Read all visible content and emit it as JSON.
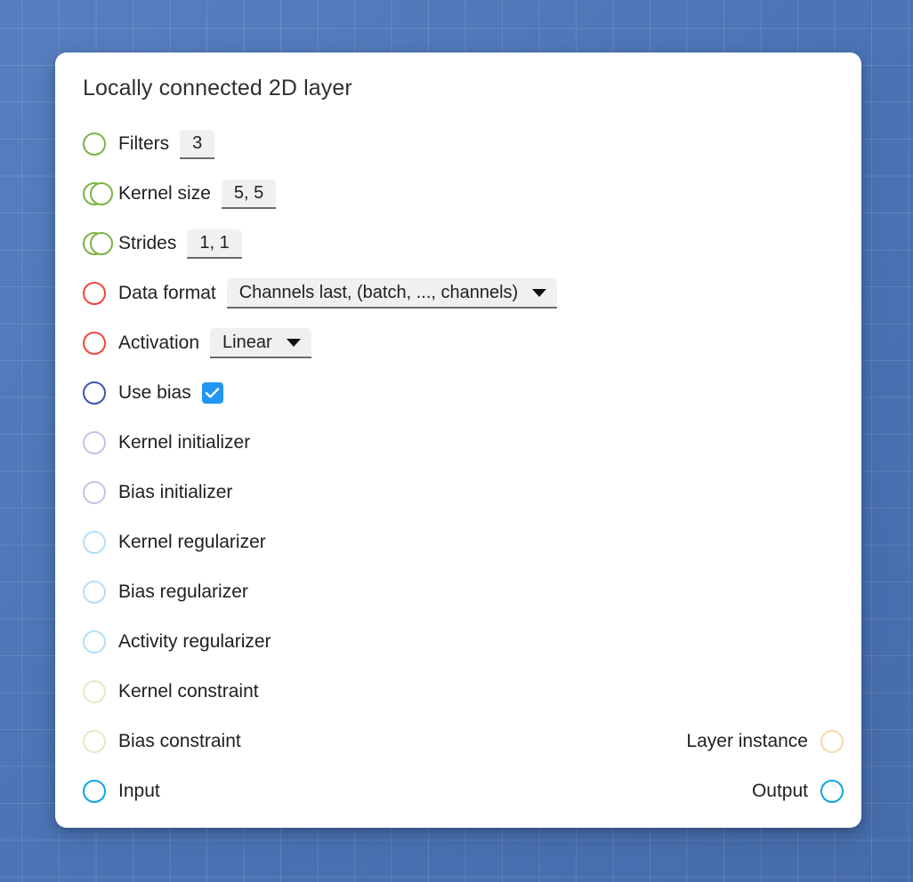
{
  "window": {
    "backdrop_color": "#4d78bd",
    "grid_line_color": "rgba(255,255,255,0.13)"
  },
  "card": {
    "title": "Locally connected 2D layer",
    "background": "#ffffff"
  },
  "rows": [
    {
      "id": "filters",
      "port_icon": "single-circle-icon",
      "port_color": "#7cb342",
      "label": "Filters",
      "control": "text-field",
      "value": "3"
    },
    {
      "id": "kernel-size",
      "port_icon": "double-circle-icon",
      "port_color": "#7cb342",
      "label": "Kernel size",
      "control": "text-field",
      "value": "5, 5"
    },
    {
      "id": "strides",
      "port_icon": "double-circle-icon",
      "port_color": "#7cb342",
      "label": "Strides",
      "control": "text-field",
      "value": "1, 1"
    },
    {
      "id": "data-format",
      "port_icon": "single-circle-icon",
      "port_color": "#f4453c",
      "label": "Data format",
      "control": "dropdown",
      "value": "Channels last, (batch, ..., channels)"
    },
    {
      "id": "activation",
      "port_icon": "single-circle-icon",
      "port_color": "#f4453c",
      "label": "Activation",
      "control": "dropdown",
      "value": "Linear"
    },
    {
      "id": "use-bias",
      "port_icon": "single-circle-icon",
      "port_color": "#3f51b5",
      "label": "Use bias",
      "control": "checkbox",
      "checked": true,
      "checkbox_color": "#2196f3"
    },
    {
      "id": "kernel-initializer",
      "port_icon": "single-circle-icon",
      "port_color": "#c5c3e8",
      "label": "Kernel initializer",
      "control": "none"
    },
    {
      "id": "bias-initializer",
      "port_icon": "single-circle-icon",
      "port_color": "#c5c3e8",
      "label": "Bias initializer",
      "control": "none"
    },
    {
      "id": "kernel-regularizer",
      "port_icon": "single-circle-icon",
      "port_color": "#b3e0f7",
      "label": "Kernel regularizer",
      "control": "none"
    },
    {
      "id": "bias-regularizer",
      "port_icon": "single-circle-icon",
      "port_color": "#b3e0f7",
      "label": "Bias regularizer",
      "control": "none"
    },
    {
      "id": "activity-regularizer",
      "port_icon": "single-circle-icon",
      "port_color": "#b3e0f7",
      "label": "Activity regularizer",
      "control": "none"
    },
    {
      "id": "kernel-constraint",
      "port_icon": "single-circle-icon",
      "port_color": "#dbeec3",
      "label": "Kernel constraint",
      "control": "none"
    },
    {
      "id": "bias-constraint",
      "port_icon": "single-circle-icon",
      "port_color": "#dbeec3",
      "label": "Bias constraint",
      "control": "none",
      "right_label": "Layer instance",
      "right_port_icon": "single-circle-icon",
      "right_port_color": "#f7d9ab"
    },
    {
      "id": "input",
      "port_icon": "single-circle-icon",
      "port_color": "#0aa3e8",
      "label": "Input",
      "control": "none",
      "right_label": "Output",
      "right_port_icon": "single-circle-icon",
      "right_port_color": "#0aa3e8"
    }
  ]
}
